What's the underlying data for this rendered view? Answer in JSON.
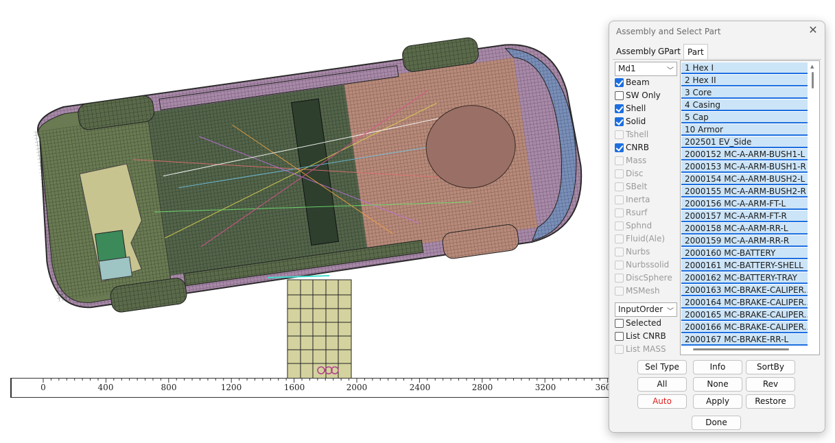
{
  "viewport": {
    "ruler_ticks": [
      "0",
      "400",
      "800",
      "1200",
      "1600",
      "2000",
      "2400",
      "2800",
      "3200",
      "360"
    ]
  },
  "dialog": {
    "title": "Assembly and Select Part",
    "close_icon": "close-icon",
    "tabs": [
      {
        "label": "Assembly",
        "active": false
      },
      {
        "label": "GPart",
        "active": false
      },
      {
        "label": "Part",
        "active": true
      }
    ],
    "model_combo": {
      "value": "Md1"
    },
    "element_types": [
      {
        "label": "Beam",
        "checked": true,
        "enabled": true
      },
      {
        "label": "SW Only",
        "checked": false,
        "enabled": true
      },
      {
        "label": "Shell",
        "checked": true,
        "enabled": true
      },
      {
        "label": "Solid",
        "checked": true,
        "enabled": true
      },
      {
        "label": "Tshell",
        "checked": false,
        "enabled": false
      },
      {
        "label": "CNRB",
        "checked": true,
        "enabled": true
      },
      {
        "label": "Mass",
        "checked": false,
        "enabled": false
      },
      {
        "label": "Disc",
        "checked": false,
        "enabled": false
      },
      {
        "label": "SBelt",
        "checked": false,
        "enabled": false
      },
      {
        "label": "Inerta",
        "checked": false,
        "enabled": false
      },
      {
        "label": "Rsurf",
        "checked": false,
        "enabled": false
      },
      {
        "label": "Sphnd",
        "checked": false,
        "enabled": false
      },
      {
        "label": "Fluid(Ale)",
        "checked": false,
        "enabled": false
      },
      {
        "label": "Nurbs",
        "checked": false,
        "enabled": false
      },
      {
        "label": "Nurbssolid",
        "checked": false,
        "enabled": false
      },
      {
        "label": "DiscSphere",
        "checked": false,
        "enabled": false
      },
      {
        "label": "MSMesh",
        "checked": false,
        "enabled": false
      }
    ],
    "order_combo": {
      "value": "InputOrder"
    },
    "list_options": [
      {
        "label": "Selected",
        "checked": false,
        "enabled": true
      },
      {
        "label": "List CNRB",
        "checked": false,
        "enabled": true
      },
      {
        "label": "List MASS",
        "checked": false,
        "enabled": false
      }
    ],
    "parts": [
      "1 Hex I",
      "2 Hex II",
      "3 Core",
      "4 Casing",
      "5 Cap",
      "10 Armor",
      "202501 EV_Side",
      "2000152 MC-A-ARM-BUSH1-L",
      "2000153 MC-A-ARM-BUSH1-R",
      "2000154 MC-A-ARM-BUSH2-L",
      "2000155 MC-A-ARM-BUSH2-R",
      "2000156 MC-A-ARM-FT-L",
      "2000157 MC-A-ARM-FT-R",
      "2000158 MC-A-ARM-RR-L",
      "2000159 MC-A-ARM-RR-R",
      "2000160 MC-BATTERY",
      "2000161 MC-BATTERY-SHELL",
      "2000162 MC-BATTERY-TRAY",
      "2000163 MC-BRAKE-CALIPER...",
      "2000164 MC-BRAKE-CALIPER...",
      "2000165 MC-BRAKE-CALIPER...",
      "2000166 MC-BRAKE-CALIPER...",
      "2000167 MC-BRAKE-RR-L"
    ],
    "buttons": {
      "sel_type": "Sel Type >>",
      "info": "Info",
      "sortby": "SortBy",
      "all": "All",
      "none": "None",
      "rev": "Rev",
      "auto": "Auto",
      "apply": "Apply",
      "restore": "Restore",
      "done": "Done"
    },
    "colors": {
      "selection": "#cce4f7",
      "accent": "#1c6ee0",
      "auto_text": "#e02020"
    }
  }
}
